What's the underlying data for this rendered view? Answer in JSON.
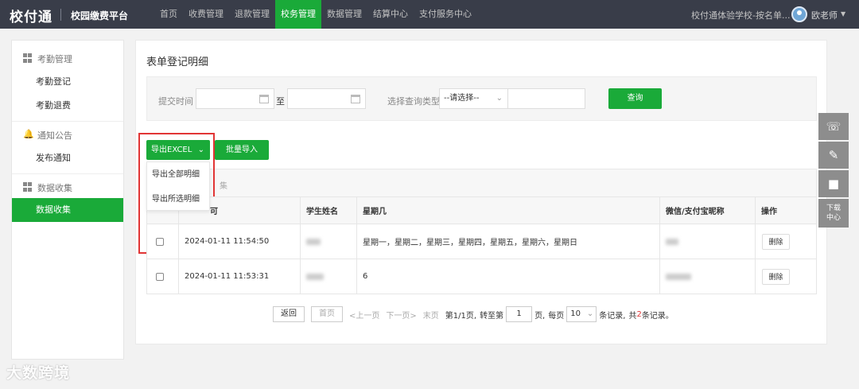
{
  "header": {
    "logo": "校付通",
    "platform": "校园缴费平台",
    "nav": [
      "首页",
      "收费管理",
      "退款管理",
      "校务管理",
      "数据管理",
      "结算中心",
      "支付服务中心"
    ],
    "active_nav_index": 3,
    "school": "校付通体验学校-按名单...",
    "user": "欧老师"
  },
  "sidebar": {
    "groups": [
      {
        "label": "考勤管理",
        "icon": "grid-icon",
        "items": [
          "考勤登记",
          "考勤退费"
        ]
      },
      {
        "label": "通知公告",
        "icon": "bell-icon",
        "items": [
          "发布通知"
        ]
      },
      {
        "label": "数据收集",
        "icon": "grid-icon",
        "items": [
          "数据收集"
        ]
      }
    ],
    "active_item": "数据收集"
  },
  "main": {
    "title": "表单登记明细",
    "filter": {
      "submit_time_label": "提交时间",
      "to_label": "至",
      "query_type_label": "选择查询类型",
      "query_type_value": "--请选择--",
      "query_button": "查询"
    },
    "export_button": "导出EXCEL",
    "import_button": "批量导入",
    "export_menu": [
      "导出全部明细",
      "导出所选明细"
    ],
    "strip_fragment": "集",
    "table": {
      "header_fragment": "可",
      "columns": [
        "学生姓名",
        "星期几",
        "微信/支付宝昵称",
        "操作"
      ],
      "rows": [
        {
          "time": "2024-01-11 11:54:50",
          "weekday": "星期一，星期二，星期三，星期四，星期五，星期六，星期日",
          "action": "删除"
        },
        {
          "time": "2024-01-11 11:53:31",
          "weekday": "6",
          "action": "删除"
        }
      ]
    },
    "pager": {
      "back": "返回",
      "first": "首页",
      "prev": "<上一页",
      "next": "下一页>",
      "last": "末页",
      "page_info": "第1/1页,",
      "goto_label": "转至第",
      "goto_value": "1",
      "page_unit": "页,",
      "per_page_label": "每页",
      "per_page_value": "10",
      "records_label": "条记录,",
      "total_prefix": "共",
      "total_count": "2",
      "total_suffix": "条记录。"
    }
  },
  "float_bar": {
    "download_center": [
      "下载",
      "中心"
    ]
  },
  "watermark": "大数跨境",
  "colors": {
    "accent": "#1aaa39",
    "topbar": "#393d49",
    "highlight": "#e13535"
  }
}
